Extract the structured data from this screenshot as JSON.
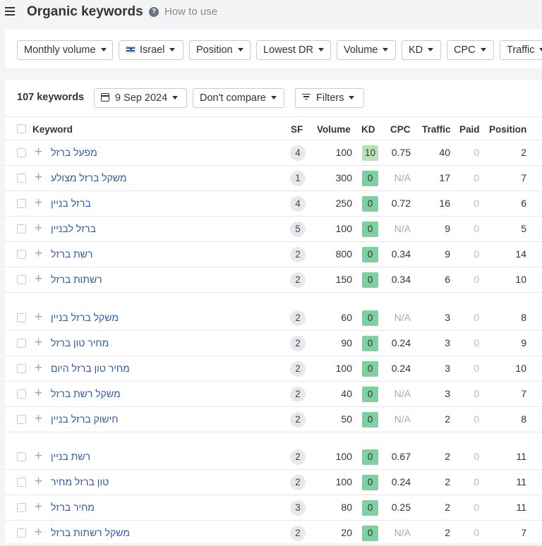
{
  "header": {
    "title": "Organic keywords",
    "help_icon": "help-circle-icon",
    "how_to_use": "How to use"
  },
  "filters": [
    {
      "label": "Monthly volume"
    },
    {
      "label": "Israel",
      "flag": "israel-flag-icon"
    },
    {
      "label": "Position"
    },
    {
      "label": "Lowest DR"
    },
    {
      "label": "Volume"
    },
    {
      "label": "KD"
    },
    {
      "label": "CPC"
    },
    {
      "label": "Traffic"
    }
  ],
  "toolbar": {
    "count": "107 keywords",
    "date": "9 Sep 2024",
    "compare": "Don't compare",
    "filters": "Filters"
  },
  "table": {
    "columns": [
      "Keyword",
      "SF",
      "Volume",
      "KD",
      "CPC",
      "Traffic",
      "Paid",
      "Position"
    ],
    "rows": [
      {
        "keyword": "מפעל ברזל",
        "sf": "4",
        "volume": "100",
        "kd": "10",
        "cpc": "0.75",
        "traffic": "40",
        "paid": "0",
        "position": "2"
      },
      {
        "keyword": "משקל ברזל מצולע",
        "sf": "1",
        "volume": "300",
        "kd": "0",
        "cpc": "N/A",
        "traffic": "17",
        "paid": "0",
        "position": "7"
      },
      {
        "keyword": "ברזל בניין",
        "sf": "4",
        "volume": "250",
        "kd": "0",
        "cpc": "0.72",
        "traffic": "16",
        "paid": "0",
        "position": "6"
      },
      {
        "keyword": "ברזל לבניין",
        "sf": "5",
        "volume": "100",
        "kd": "0",
        "cpc": "N/A",
        "traffic": "9",
        "paid": "0",
        "position": "5"
      },
      {
        "keyword": "רשת ברזל",
        "sf": "2",
        "volume": "800",
        "kd": "0",
        "cpc": "0.34",
        "traffic": "9",
        "paid": "0",
        "position": "14"
      },
      {
        "keyword": "רשתות ברזל",
        "sf": "2",
        "volume": "150",
        "kd": "0",
        "cpc": "0.34",
        "traffic": "6",
        "paid": "0",
        "position": "10"
      },
      {
        "keyword": "משקל ברזל בניין",
        "sf": "2",
        "volume": "60",
        "kd": "0",
        "cpc": "N/A",
        "traffic": "3",
        "paid": "0",
        "position": "8"
      },
      {
        "keyword": "מחיר טון ברזל",
        "sf": "2",
        "volume": "90",
        "kd": "0",
        "cpc": "0.24",
        "traffic": "3",
        "paid": "0",
        "position": "9"
      },
      {
        "keyword": "מחיר טון ברזל היום",
        "sf": "2",
        "volume": "100",
        "kd": "0",
        "cpc": "0.24",
        "traffic": "3",
        "paid": "0",
        "position": "10"
      },
      {
        "keyword": "משקל רשת ברזל",
        "sf": "2",
        "volume": "40",
        "kd": "0",
        "cpc": "N/A",
        "traffic": "3",
        "paid": "0",
        "position": "7"
      },
      {
        "keyword": "חישוק ברזל בניין",
        "sf": "2",
        "volume": "50",
        "kd": "0",
        "cpc": "N/A",
        "traffic": "2",
        "paid": "0",
        "position": "8"
      },
      {
        "keyword": "רשת בניין",
        "sf": "2",
        "volume": "100",
        "kd": "0",
        "cpc": "0.67",
        "traffic": "2",
        "paid": "0",
        "position": "11"
      },
      {
        "keyword": "טון ברזל מחיר",
        "sf": "2",
        "volume": "100",
        "kd": "0",
        "cpc": "0.24",
        "traffic": "2",
        "paid": "0",
        "position": "11"
      },
      {
        "keyword": "מחיר ברזל",
        "sf": "3",
        "volume": "80",
        "kd": "0",
        "cpc": "0.25",
        "traffic": "2",
        "paid": "0",
        "position": "11"
      },
      {
        "keyword": "משקל רשתות ברזל",
        "sf": "2",
        "volume": "20",
        "kd": "0",
        "cpc": "N/A",
        "traffic": "2",
        "paid": "0",
        "position": "7"
      }
    ]
  },
  "colors": {
    "kd_green": "#7fd0a0",
    "kd_light_green": "#b8e3b6",
    "keyword_link": "#2d5aa8"
  }
}
